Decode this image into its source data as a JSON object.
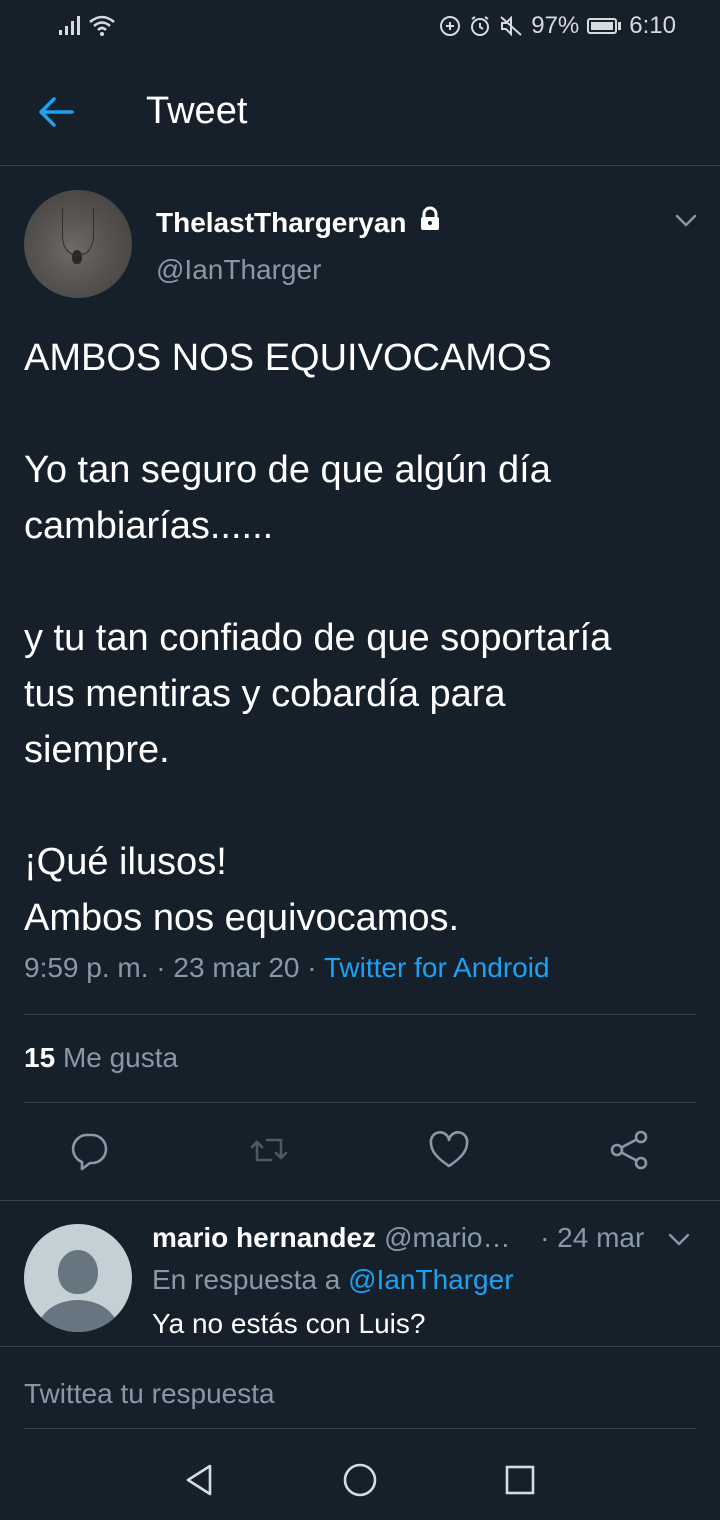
{
  "status_bar": {
    "battery": "97%",
    "time": "6:10"
  },
  "header": {
    "title": "Tweet"
  },
  "tweet": {
    "author_name": "ThelastThargeryan",
    "author_handle": "@IanTharger",
    "paragraphs": [
      [
        "AMBOS  NOS EQUIVOCAMOS"
      ],
      [
        "Yo tan seguro de que algún día",
        "cambiarías......"
      ],
      [
        "y tu tan confiado de que soportaría",
        "tus mentiras y cobardía para",
        "siempre."
      ],
      [
        "¡Qué ilusos!",
        "Ambos nos equivocamos."
      ]
    ],
    "time": "9:59 p. m.",
    "date": "23 mar 20",
    "source": "Twitter for Android",
    "likes_count": "15",
    "likes_label": "Me gusta"
  },
  "reply": {
    "name": "mario hernandez",
    "handle": "@mario…",
    "date": "· 24 mar",
    "in_reply_prefix": "En respuesta a",
    "in_reply_mention": "@IanTharger",
    "text": "Ya no estás con Luis?"
  },
  "compose": {
    "placeholder": "Twittea tu respuesta"
  },
  "colors": {
    "background": "#15202b",
    "accent": "#1da1f2",
    "secondary_text": "#8899a6",
    "divider": "#38444d"
  }
}
